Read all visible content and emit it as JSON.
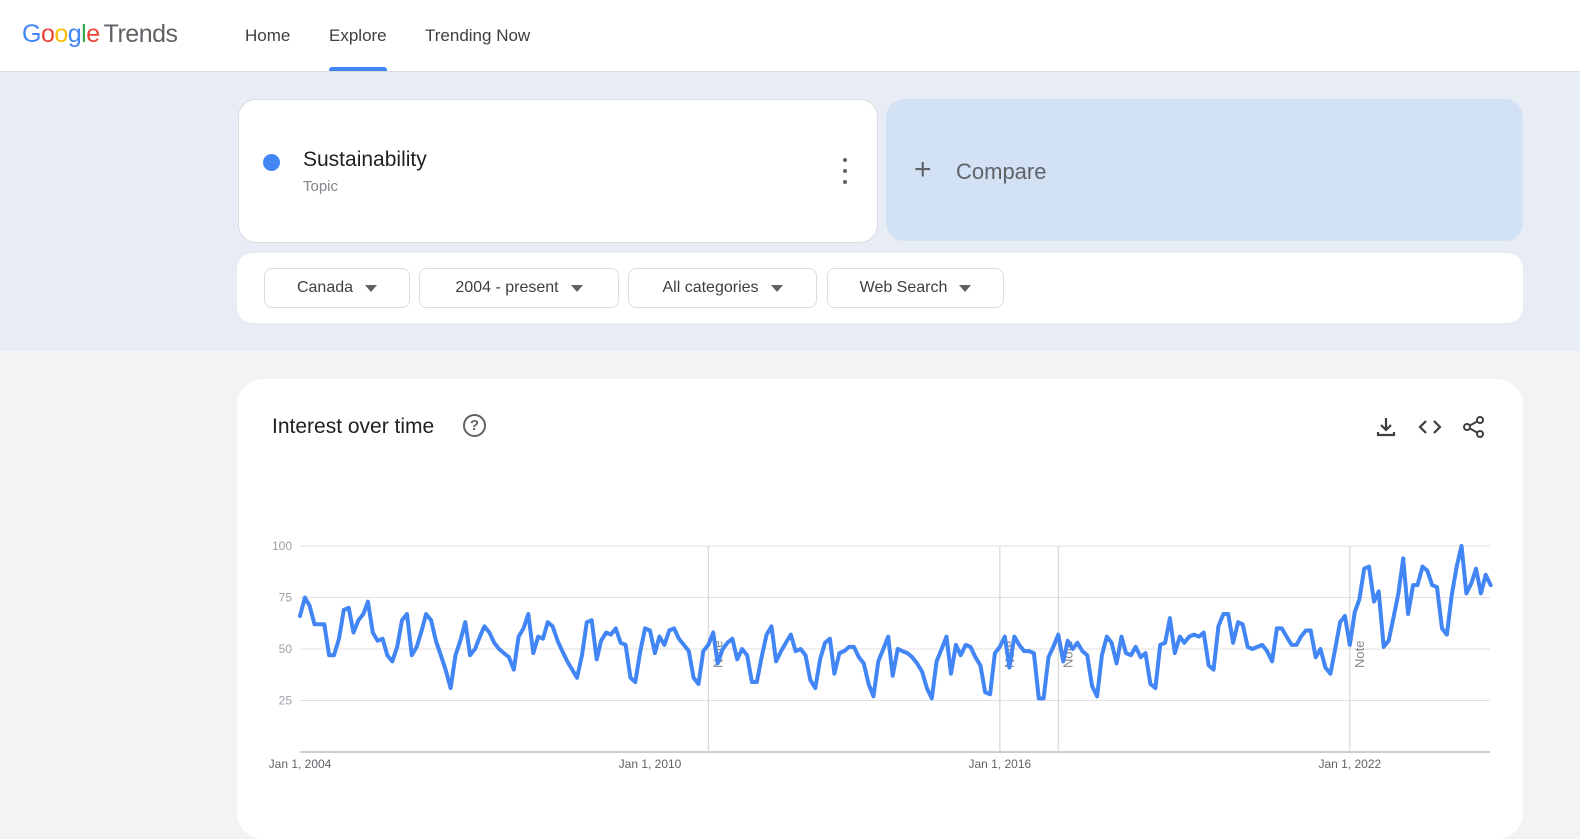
{
  "app": {
    "logo_letters": [
      "G",
      "o",
      "o",
      "g",
      "l",
      "e"
    ],
    "logo_suffix": "Trends"
  },
  "nav": {
    "home": "Home",
    "explore": "Explore",
    "trending": "Trending Now",
    "active": "Explore"
  },
  "search_term": {
    "name": "Sustainability",
    "type": "Topic",
    "color": "#4285f4"
  },
  "compare": {
    "plus": "+",
    "label": "Compare"
  },
  "filters": {
    "region": "Canada",
    "period": "2004 - present",
    "category": "All categories",
    "property": "Web Search"
  },
  "interest_card": {
    "title": "Interest over time",
    "help_icon": "help-circle-icon",
    "actions": [
      "download-icon",
      "embed-code-icon",
      "share-icon"
    ]
  },
  "chart_data": {
    "type": "line",
    "title": "Interest over time",
    "y_ticks": [
      25,
      50,
      75,
      100
    ],
    "y_tick_labels": [
      "25",
      "50",
      "75",
      "100"
    ],
    "ylim": [
      0,
      100
    ],
    "xlim": [
      "2004-01-01",
      "2025-12-31"
    ],
    "x_ticks": [
      "2004-01-01",
      "2010-01-01",
      "2016-01-01",
      "2022-01-01"
    ],
    "x_tick_labels": [
      "Jan 1, 2004",
      "Jan 1, 2010",
      "Jan 1, 2016",
      "Jan 1, 2022"
    ],
    "notes": [
      {
        "date": "2011-01-01",
        "label": "Note"
      },
      {
        "date": "2016-01-01",
        "label": "Note"
      },
      {
        "date": "2017-01-01",
        "label": "Note"
      },
      {
        "date": "2022-01-01",
        "label": "Note"
      }
    ],
    "grid": true,
    "color": "#4285f4",
    "series": [
      {
        "start": "2004-01",
        "frequency": "monthly",
        "values": [
          66,
          75,
          71,
          62,
          62,
          62,
          47,
          47,
          55,
          69,
          70,
          58,
          64,
          67,
          73,
          58,
          54,
          55,
          47,
          44,
          51,
          64,
          67,
          47,
          51,
          59,
          67,
          64,
          54,
          47,
          40,
          31,
          47,
          54,
          63,
          47,
          50,
          56,
          61,
          58,
          53,
          50,
          48,
          46,
          40,
          56,
          60,
          67,
          48,
          56,
          55,
          63,
          61,
          54,
          49,
          44,
          40,
          36,
          47,
          63,
          64,
          45,
          54,
          58,
          57,
          60,
          53,
          52,
          36,
          34,
          49,
          60,
          59,
          48,
          56,
          52,
          59,
          60,
          55,
          52,
          49,
          36,
          33,
          49,
          52,
          58,
          43,
          50,
          53,
          55,
          45,
          50,
          47,
          34,
          34,
          46,
          57,
          61,
          44,
          49,
          53,
          57,
          49,
          50,
          47,
          35,
          31,
          45,
          53,
          55,
          38,
          48,
          49,
          51,
          51,
          46,
          43,
          33,
          27,
          44,
          50,
          56,
          37,
          50,
          49,
          48,
          46,
          43,
          39,
          31,
          26,
          44,
          50,
          56,
          38,
          52,
          47,
          52,
          51,
          46,
          42,
          29,
          28,
          48,
          51,
          56,
          41,
          56,
          52,
          49,
          49,
          48,
          26,
          26,
          46,
          51,
          57,
          44,
          54,
          50,
          53,
          49,
          47,
          32,
          27,
          47,
          56,
          53,
          43,
          56,
          48,
          47,
          51,
          46,
          48,
          33,
          31,
          52,
          53,
          65,
          48,
          56,
          53,
          56,
          57,
          56,
          58,
          42,
          40,
          61,
          67,
          67,
          53,
          63,
          62,
          51,
          50,
          51,
          52,
          49,
          44,
          60,
          60,
          56,
          52,
          52,
          56,
          59,
          59,
          46,
          50,
          41,
          38,
          50,
          63,
          66,
          52,
          68,
          74,
          89,
          90,
          73,
          78,
          51,
          54,
          65,
          77,
          94,
          67,
          81,
          81,
          90,
          88,
          81,
          80,
          60,
          57,
          76,
          90,
          100,
          77,
          82,
          89,
          77,
          86,
          81
        ]
      }
    ]
  }
}
